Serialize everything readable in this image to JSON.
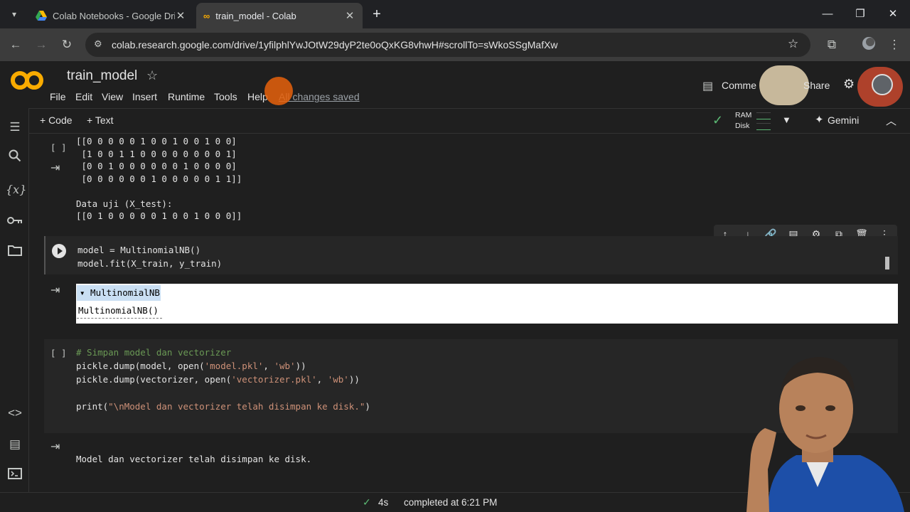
{
  "browser": {
    "tabs": [
      {
        "title": "Colab Notebooks - Google Driv",
        "active": false
      },
      {
        "title": "train_model - Colab",
        "active": true
      }
    ],
    "url": "colab.research.google.com/drive/1yfilphlYwJOtW29dyP2te0oQxKG8vhwH#scrollTo=sWkoSSgMafXw"
  },
  "colab": {
    "notebook_title": "train_model",
    "menu": [
      "File",
      "Edit",
      "View",
      "Insert",
      "Runtime",
      "Tools",
      "Help"
    ],
    "save_status": "All changes saved",
    "comment_label": "Comme",
    "share_label": "Share",
    "add_code_label": "+ Code",
    "add_text_label": "+ Text",
    "ram_label": "RAM",
    "disk_label": "Disk",
    "gemini_label": "Gemini",
    "status_duration": "4s",
    "status_text": "completed at 6:21 PM"
  },
  "cells": {
    "output1_lines": "[[0 0 0 0 0 1 0 0 1 0 0 1 0 0]\n [1 0 0 1 1 0 0 0 0 0 0 0 0 1]\n [0 0 1 0 0 0 0 0 0 1 0 0 0 0]\n [0 0 0 0 0 0 1 0 0 0 0 0 1 1]]\n\nData uji (X_test):\n[[0 1 0 0 0 0 0 1 0 0 1 0 0 0]]",
    "bracket_empty": "[ ]",
    "code2_line1": "model = MultinomialNB()",
    "code2_line2_a": "model.fit",
    "code2_line2_b": "(X_train, y_train)",
    "output2_header": "▾ MultinomialNB",
    "output2_body": "MultinomialNB()",
    "code3_comment": "# Simpan model dan vectorizer",
    "code3_line2_a": "pickle.dump(model, open(",
    "code3_line2_s1": "'model.pkl'",
    "code3_line2_m": ", ",
    "code3_line2_s2": "'wb'",
    "code3_line2_e": "))",
    "code3_line3_a": "pickle.dump(vectorizer, open(",
    "code3_line3_s1": "'vectorizer.pkl'",
    "code3_line3_m": ", ",
    "code3_line3_s2": "'wb'",
    "code3_line3_e": "))",
    "code3_line4_a": "print(",
    "code3_line4_s": "\"\\nModel dan vectorizer telah disimpan ke disk.\"",
    "code3_line4_e": ")",
    "output3": "Model dan vectorizer telah disimpan ke disk."
  },
  "colors": {
    "accent_orange": "#f9ab00",
    "check_green": "#5bb974",
    "string": "#ce9178",
    "comment": "#6a9955"
  }
}
